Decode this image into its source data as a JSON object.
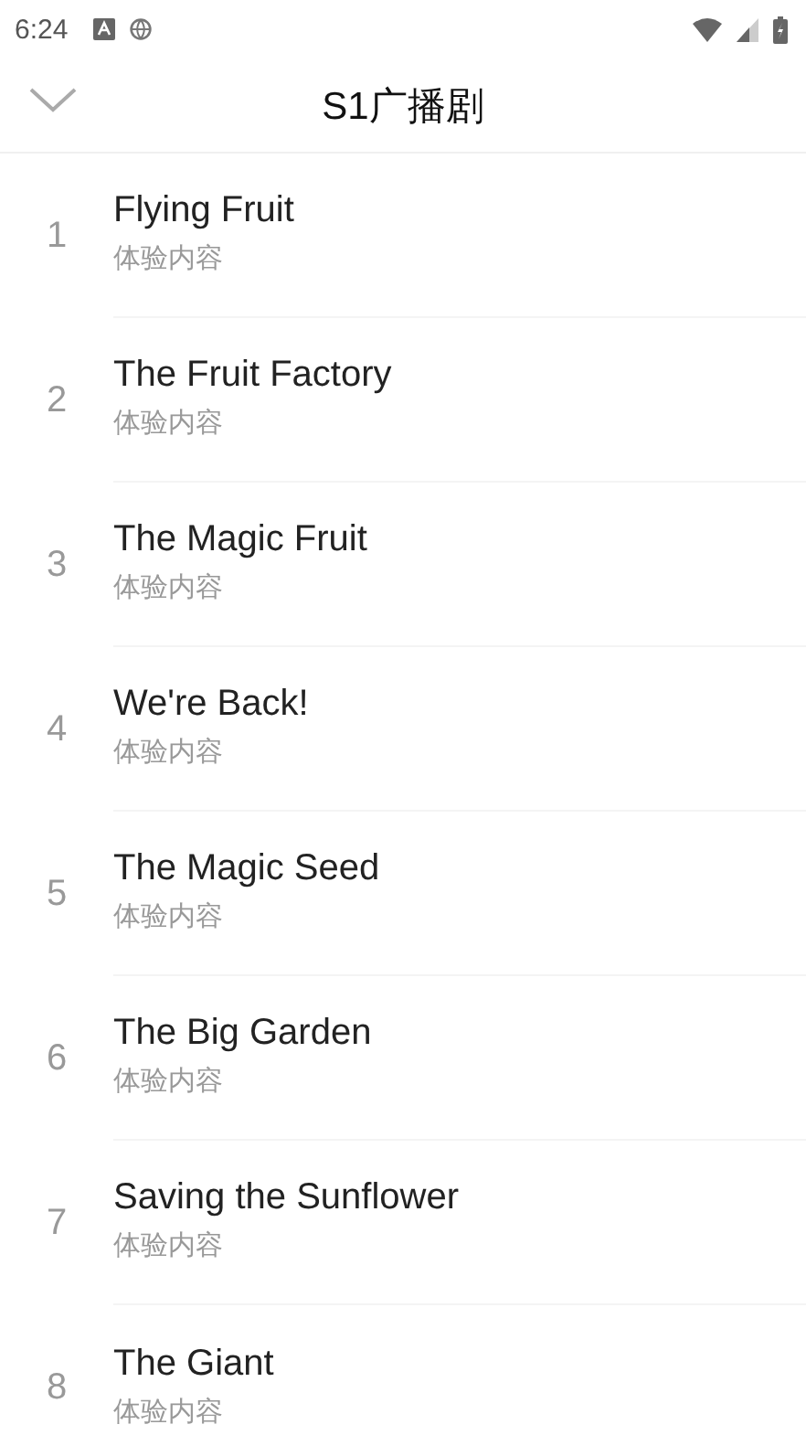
{
  "status_bar": {
    "time": "6:24"
  },
  "header": {
    "title": "S1广播剧"
  },
  "episodes": [
    {
      "number": "1",
      "title": "Flying Fruit",
      "subtitle": "体验内容"
    },
    {
      "number": "2",
      "title": "The Fruit Factory",
      "subtitle": "体验内容"
    },
    {
      "number": "3",
      "title": "The Magic Fruit",
      "subtitle": "体验内容"
    },
    {
      "number": "4",
      "title": "We're Back!",
      "subtitle": "体验内容"
    },
    {
      "number": "5",
      "title": "The Magic Seed",
      "subtitle": "体验内容"
    },
    {
      "number": "6",
      "title": "The Big Garden",
      "subtitle": "体验内容"
    },
    {
      "number": "7",
      "title": "Saving the Sunflower",
      "subtitle": "体验内容"
    },
    {
      "number": "8",
      "title": "The Giant",
      "subtitle": "体验内容"
    }
  ]
}
